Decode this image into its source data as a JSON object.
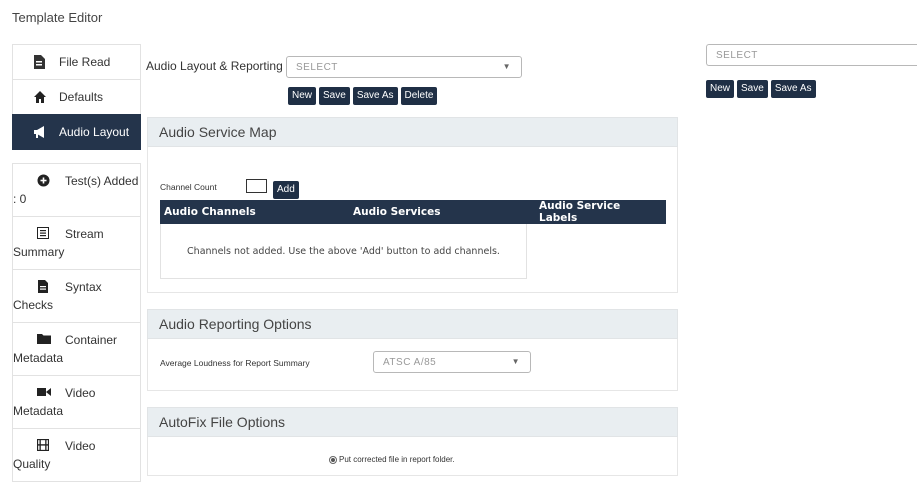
{
  "page_title": "Template Editor",
  "sidebar": {
    "items": [
      {
        "label": "File Read",
        "icon": "file-icon"
      },
      {
        "label": "Defaults",
        "icon": "home-icon"
      },
      {
        "label": "Audio Layout",
        "icon": "megaphone-icon",
        "active": true
      },
      {
        "label_line1": "Test(s) Added",
        "label_line2": ": 0",
        "icon": "add-circle-icon"
      },
      {
        "label_line1": "Stream",
        "label_line2": "Summary",
        "icon": "list-icon"
      },
      {
        "label_line1": "Syntax",
        "label_line2": "Checks",
        "icon": "document-icon"
      },
      {
        "label_line1": "Container",
        "label_line2": "Metadata",
        "icon": "folder-icon"
      },
      {
        "label_line1": "Video",
        "label_line2": "Metadata",
        "icon": "video-camera-icon"
      },
      {
        "label_line1": "Video",
        "label_line2": "Quality",
        "icon": "film-icon"
      }
    ]
  },
  "audio_layout_reporting": {
    "label": "Audio Layout & Reporting",
    "select_value": "SELECT",
    "buttons": {
      "new": "New",
      "save": "Save",
      "save_as": "Save As",
      "delete": "Delete"
    }
  },
  "right_panel": {
    "select_value": "SELECT",
    "buttons": {
      "new": "New",
      "save": "Save",
      "save_as": "Save As"
    }
  },
  "audio_service_map": {
    "heading": "Audio Service Map",
    "channel_count_label": "Channel Count",
    "channel_count_value": "",
    "add_button": "Add",
    "columns": [
      "Audio Channels",
      "Audio Services",
      "Audio Service Labels"
    ],
    "empty_message": "Channels not added. Use the above 'Add' button to add channels."
  },
  "audio_reporting_options": {
    "heading": "Audio Reporting Options",
    "loudness_label": "Average Loudness for Report Summary",
    "loudness_value": "ATSC A/85"
  },
  "autofix_options": {
    "heading": "AutoFix File Options",
    "radio_label": "Put corrected file in report folder."
  },
  "colors": {
    "nav_active": "#24344b",
    "button": "#1f2f45",
    "panel_header": "#e9eef1"
  }
}
